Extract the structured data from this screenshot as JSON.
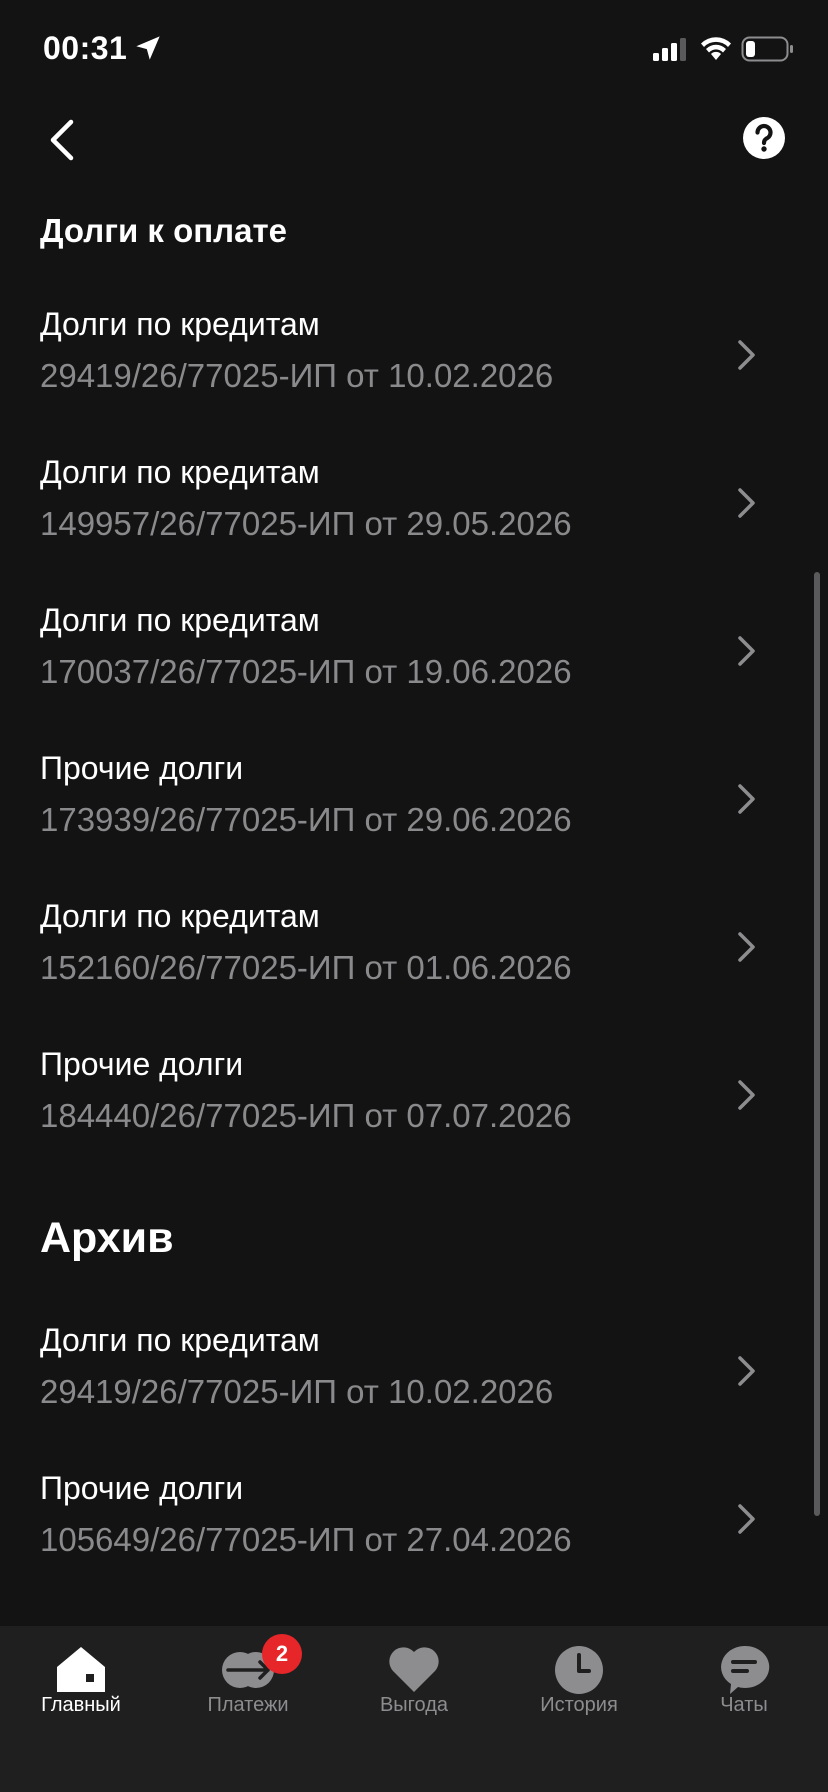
{
  "status_bar": {
    "time": "00:31"
  },
  "debts_section": {
    "title": "Долги к оплате",
    "items": [
      {
        "title": "Долги по кредитам",
        "subtitle": "29419/26/77025-ИП от 10.02.2026"
      },
      {
        "title": "Долги по кредитам",
        "subtitle": "149957/26/77025-ИП от 29.05.2026"
      },
      {
        "title": "Долги по кредитам",
        "subtitle": "170037/26/77025-ИП от 19.06.2026"
      },
      {
        "title": "Прочие долги",
        "subtitle": "173939/26/77025-ИП от 29.06.2026"
      },
      {
        "title": "Долги по кредитам",
        "subtitle": "152160/26/77025-ИП от 01.06.2026"
      },
      {
        "title": "Прочие долги",
        "subtitle": "184440/26/77025-ИП от 07.07.2026"
      }
    ]
  },
  "archive_section": {
    "title": "Архив",
    "items": [
      {
        "title": "Долги по кредитам",
        "subtitle": "29419/26/77025-ИП от 10.02.2026"
      },
      {
        "title": "Прочие долги",
        "subtitle": "105649/26/77025-ИП от 27.04.2026"
      }
    ]
  },
  "tab_bar": {
    "tabs": [
      {
        "label": "Главный",
        "icon": "home-icon",
        "active": true
      },
      {
        "label": "Платежи",
        "icon": "payments-icon",
        "badge": "2"
      },
      {
        "label": "Выгода",
        "icon": "heart-icon"
      },
      {
        "label": "История",
        "icon": "clock-icon"
      },
      {
        "label": "Чаты",
        "icon": "chat-icon"
      }
    ]
  },
  "colors": {
    "background": "#131313",
    "tab_bar_bg": "#1f1f1f",
    "secondary_text": "#8a8a8d",
    "badge": "#e7262a"
  }
}
